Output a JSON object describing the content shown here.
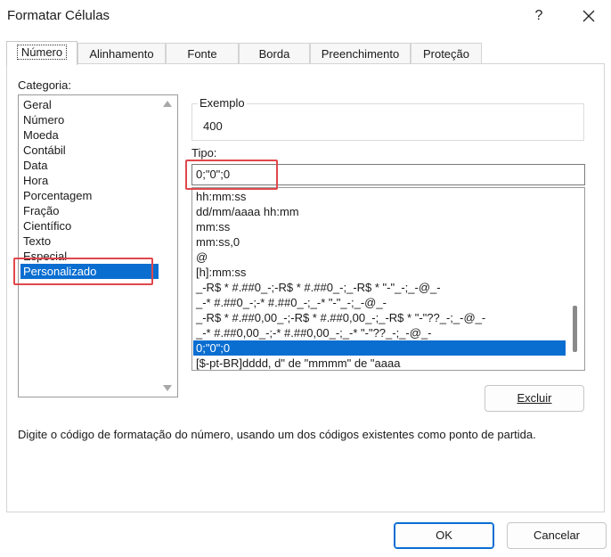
{
  "window": {
    "title": "Formatar Células",
    "help_glyph": "?",
    "close_icon": "close-icon"
  },
  "tabs": [
    {
      "label": "Número",
      "active": true
    },
    {
      "label": "Alinhamento"
    },
    {
      "label": "Fonte"
    },
    {
      "label": "Borda"
    },
    {
      "label": "Preenchimento"
    },
    {
      "label": "Proteção"
    }
  ],
  "categoria": {
    "label": "Categoria:",
    "items": [
      "Geral",
      "Número",
      "Moeda",
      "Contábil",
      "Data",
      "Hora",
      "Porcentagem",
      "Fração",
      "Científico",
      "Texto",
      "Especial",
      "Personalizado"
    ],
    "selected": "Personalizado"
  },
  "exemplo": {
    "label": "Exemplo",
    "value": "400"
  },
  "tipo": {
    "label": "Tipo:",
    "value": "0;\"0\";0",
    "formats": [
      "hh:mm:ss",
      "dd/mm/aaaa hh:mm",
      "mm:ss",
      "mm:ss,0",
      "@",
      "[h]:mm:ss",
      "_-R$ * #.##0_-;-R$ * #.##0_-;_-R$ * \"-\"_-;_-@_-",
      "_-* #.##0_-;-* #.##0_-;_-* \"-\"_-;_-@_-",
      "_-R$ * #.##0,00_-;-R$ * #.##0,00_-;_-R$ * \"-\"??_-;_-@_-",
      "_-* #.##0,00_-;-* #.##0,00_-;_-* \"-\"??_-;_-@_-",
      "0;\"0\";0",
      "[$-pt-BR]dddd, d\" de \"mmmm\" de \"aaaa"
    ],
    "selected": "0;\"0\";0"
  },
  "buttons": {
    "excluir": "Excluir",
    "ok": "OK",
    "cancelar": "Cancelar"
  },
  "hint": "Digite o código de formatação do número, usando um dos códigos existentes como ponto de partida.",
  "colors": {
    "selection": "#0a6ed1",
    "highlight": "#e0474c"
  }
}
